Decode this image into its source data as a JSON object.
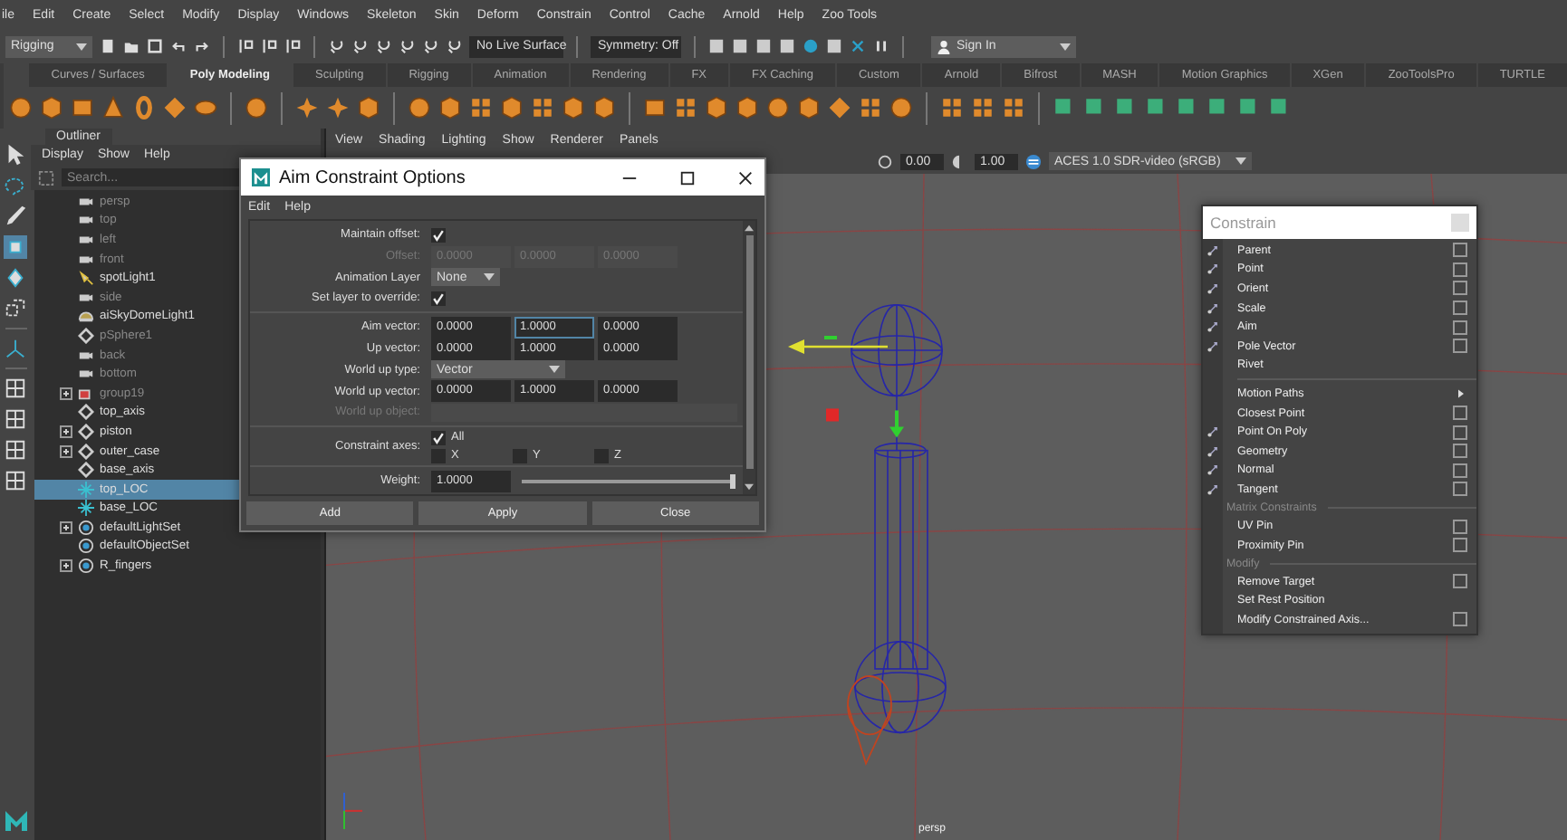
{
  "menubar": [
    "ile",
    "Edit",
    "Create",
    "Select",
    "Modify",
    "Display",
    "Windows",
    "Skeleton",
    "Skin",
    "Deform",
    "Constrain",
    "Control",
    "Cache",
    "Arnold",
    "Help",
    "Zoo Tools"
  ],
  "status_line": {
    "mode": "Rigging",
    "live_surface": "No Live Surface",
    "symmetry": "Symmetry: Off",
    "sign_in": "Sign In"
  },
  "shelf_tabs": [
    {
      "label": "Curves / Surfaces",
      "selected": false
    },
    {
      "label": "Poly Modeling",
      "selected": true
    },
    {
      "label": "Sculpting",
      "selected": false
    },
    {
      "label": "Rigging",
      "selected": false
    },
    {
      "label": "Animation",
      "selected": false
    },
    {
      "label": "Rendering",
      "selected": false
    },
    {
      "label": "FX",
      "selected": false
    },
    {
      "label": "FX Caching",
      "selected": false
    },
    {
      "label": "Custom",
      "selected": false
    },
    {
      "label": "Arnold",
      "selected": false
    },
    {
      "label": "Bifrost",
      "selected": false
    },
    {
      "label": "MASH",
      "selected": false
    },
    {
      "label": "Motion Graphics",
      "selected": false
    },
    {
      "label": "XGen",
      "selected": false
    },
    {
      "label": "ZooToolsPro",
      "selected": false
    },
    {
      "label": "TURTLE",
      "selected": false
    }
  ],
  "outliner": {
    "tab": "Outliner",
    "menu": [
      "Display",
      "Show",
      "Help"
    ],
    "search": {
      "placeholder": "Search..."
    },
    "items": [
      {
        "label": "persp",
        "kind": "camera",
        "hidden": true,
        "expandable": false,
        "selected": false
      },
      {
        "label": "top",
        "kind": "camera",
        "hidden": true,
        "expandable": false,
        "selected": false
      },
      {
        "label": "left",
        "kind": "camera",
        "hidden": true,
        "expandable": false,
        "selected": false
      },
      {
        "label": "front",
        "kind": "camera",
        "hidden": true,
        "expandable": false,
        "selected": false
      },
      {
        "label": "spotLight1",
        "kind": "light",
        "hidden": false,
        "expandable": false,
        "selected": false
      },
      {
        "label": "side",
        "kind": "camera",
        "hidden": true,
        "expandable": false,
        "selected": false
      },
      {
        "label": "aiSkyDomeLight1",
        "kind": "dome",
        "hidden": false,
        "expandable": false,
        "selected": false
      },
      {
        "label": "pSphere1",
        "kind": "transform",
        "hidden": true,
        "expandable": false,
        "selected": false
      },
      {
        "label": "back",
        "kind": "camera",
        "hidden": true,
        "expandable": false,
        "selected": false
      },
      {
        "label": "bottom",
        "kind": "camera",
        "hidden": true,
        "expandable": false,
        "selected": false
      },
      {
        "label": "group19",
        "kind": "group",
        "hidden": true,
        "expandable": true,
        "selected": false
      },
      {
        "label": "top_axis",
        "kind": "transform",
        "hidden": false,
        "expandable": false,
        "selected": false
      },
      {
        "label": "piston",
        "kind": "transform",
        "hidden": false,
        "expandable": true,
        "selected": false
      },
      {
        "label": "outer_case",
        "kind": "transform",
        "hidden": false,
        "expandable": true,
        "selected": false
      },
      {
        "label": "base_axis",
        "kind": "transform",
        "hidden": false,
        "expandable": false,
        "selected": false
      },
      {
        "label": "top_LOC",
        "kind": "locator",
        "hidden": false,
        "expandable": false,
        "selected": true
      },
      {
        "label": "base_LOC",
        "kind": "locator",
        "hidden": false,
        "expandable": false,
        "selected": false
      },
      {
        "label": "defaultLightSet",
        "kind": "set",
        "hidden": false,
        "expandable": true,
        "selected": false
      },
      {
        "label": "defaultObjectSet",
        "kind": "set",
        "hidden": false,
        "expandable": false,
        "selected": false
      },
      {
        "label": "R_fingers",
        "kind": "set",
        "hidden": false,
        "expandable": true,
        "selected": false
      }
    ]
  },
  "viewport": {
    "menu": [
      "View",
      "Shading",
      "Lighting",
      "Show",
      "Renderer",
      "Panels"
    ],
    "exposure": "0.00",
    "gamma": "1.00",
    "color_space": "ACES 1.0 SDR-video (sRGB)",
    "camera": "persp"
  },
  "dialog": {
    "title": "Aim Constraint Options",
    "menu": [
      "Edit",
      "Help"
    ],
    "rows": [
      {
        "kind": "checkbox",
        "label": "Maintain offset:",
        "checked": true,
        "disabled": false
      },
      {
        "kind": "vector",
        "label": "Offset:",
        "values": [
          "0.0000",
          "0.0000",
          "0.0000"
        ],
        "disabled": true
      },
      {
        "kind": "dropdown",
        "label": "Animation Layer",
        "value": "None",
        "disabled": false
      },
      {
        "kind": "checkbox",
        "label": "Set layer to override:",
        "checked": true,
        "disabled": false
      },
      {
        "kind": "separator"
      },
      {
        "kind": "vector",
        "label": "Aim vector:",
        "values": [
          "0.0000",
          "1.0000",
          "0.0000"
        ],
        "disabled": false
      },
      {
        "kind": "vector",
        "label": "Up vector:",
        "values": [
          "0.0000",
          "1.0000",
          "0.0000"
        ],
        "disabled": false
      },
      {
        "kind": "dropdown",
        "label": "World up type:",
        "value": "Vector",
        "disabled": false
      },
      {
        "kind": "vector",
        "label": "World up vector:",
        "values": [
          "0.0000",
          "1.0000",
          "0.0000"
        ],
        "disabled": false
      },
      {
        "kind": "text",
        "label": "World up object:",
        "disabled": true
      },
      {
        "kind": "separator"
      },
      {
        "kind": "axes",
        "label": "Constraint axes:",
        "all": {
          "label": "All",
          "checked": true
        },
        "axes": [
          {
            "label": "X",
            "checked": false
          },
          {
            "label": "Y",
            "checked": false
          },
          {
            "label": "Z",
            "checked": false
          }
        ]
      },
      {
        "kind": "separator"
      },
      {
        "kind": "slider",
        "label": "Weight:",
        "value": "1.0000",
        "level": 1
      }
    ],
    "buttons": [
      "Add",
      "Apply",
      "Close"
    ]
  },
  "constrain_menu": {
    "title": "Constrain",
    "items": [
      {
        "kind": "item",
        "label": "Parent",
        "option_box": true,
        "icon": true,
        "submenu": false
      },
      {
        "kind": "item",
        "label": "Point",
        "option_box": true,
        "icon": true,
        "submenu": false
      },
      {
        "kind": "item",
        "label": "Orient",
        "option_box": true,
        "icon": true,
        "submenu": false
      },
      {
        "kind": "item",
        "label": "Scale",
        "option_box": true,
        "icon": true,
        "submenu": false
      },
      {
        "kind": "item",
        "label": "Aim",
        "option_box": true,
        "icon": true,
        "submenu": false
      },
      {
        "kind": "item",
        "label": "Pole Vector",
        "option_box": true,
        "icon": true,
        "submenu": false
      },
      {
        "kind": "item",
        "label": "Rivet",
        "option_box": false,
        "icon": false,
        "submenu": false
      },
      {
        "kind": "separator"
      },
      {
        "kind": "item",
        "label": "Motion Paths",
        "option_box": false,
        "icon": false,
        "submenu": true
      },
      {
        "kind": "item",
        "label": "Closest Point",
        "option_box": true,
        "icon": false,
        "submenu": false
      },
      {
        "kind": "item",
        "label": "Point On Poly",
        "option_box": true,
        "icon": true,
        "submenu": false
      },
      {
        "kind": "item",
        "label": "Geometry",
        "option_box": true,
        "icon": true,
        "submenu": false
      },
      {
        "kind": "item",
        "label": "Normal",
        "option_box": true,
        "icon": true,
        "submenu": false
      },
      {
        "kind": "item",
        "label": "Tangent",
        "option_box": true,
        "icon": true,
        "submenu": false
      },
      {
        "kind": "header",
        "label": "Matrix Constraints"
      },
      {
        "kind": "item",
        "label": "UV Pin",
        "option_box": true,
        "icon": false,
        "submenu": false
      },
      {
        "kind": "item",
        "label": "Proximity Pin",
        "option_box": true,
        "icon": false,
        "submenu": false
      },
      {
        "kind": "header",
        "label": "Modify"
      },
      {
        "kind": "item",
        "label": "Remove Target",
        "option_box": true,
        "icon": false,
        "submenu": false
      },
      {
        "kind": "item",
        "label": "Set Rest Position",
        "option_box": false,
        "icon": false,
        "submenu": false
      },
      {
        "kind": "item",
        "label": "Modify Constrained Axis...",
        "option_box": true,
        "icon": false,
        "submenu": false
      }
    ]
  }
}
